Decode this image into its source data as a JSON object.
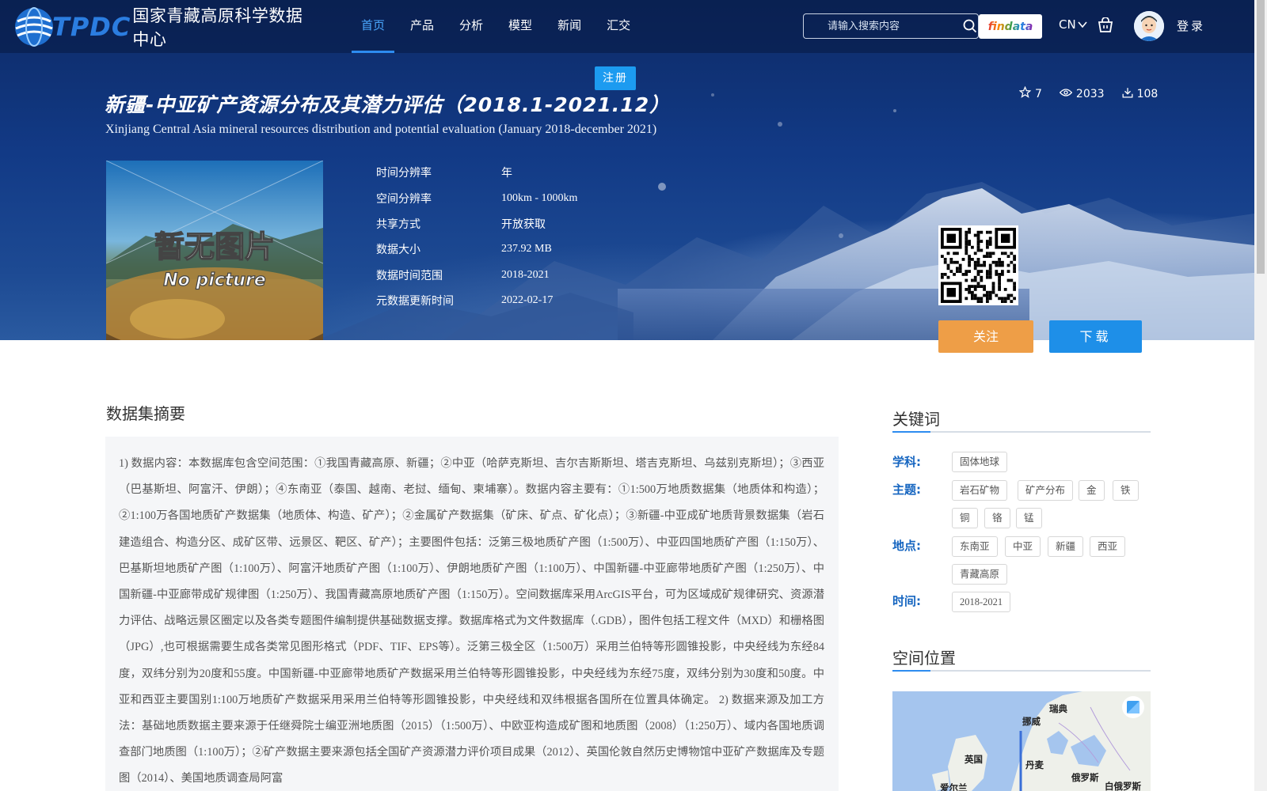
{
  "header": {
    "logo_text": "TPDC",
    "logo_cn": "国家青藏高原科学数据中心",
    "nav": [
      {
        "label": "首页",
        "active": true
      },
      {
        "label": "产品"
      },
      {
        "label": "分析"
      },
      {
        "label": "模型"
      },
      {
        "label": "新闻"
      },
      {
        "label": "汇交"
      }
    ],
    "search_placeholder": "请输入搜索内容",
    "findata_label": "findata",
    "lang_label": "CN",
    "login_label": "登录",
    "register_label": "注册"
  },
  "dataset": {
    "title_cn": "新疆-中亚矿产资源分布及其潜力评估（2018.1-2021.12）",
    "title_en": "Xinjiang Central Asia mineral resources distribution and potential evaluation (January 2018-december 2021)",
    "stats": {
      "stars": "7",
      "views": "2033",
      "downloads": "108"
    },
    "thumbnail": {
      "text_cn": "暂无图片",
      "text_en": "No picture"
    },
    "meta": [
      {
        "label": "时间分辨率",
        "value": "年"
      },
      {
        "label": "空间分辨率",
        "value": "100km - 1000km"
      },
      {
        "label": "共享方式",
        "value": "开放获取"
      },
      {
        "label": "数据大小",
        "value": "237.92 MB"
      },
      {
        "label": "数据时间范围",
        "value": "2018-2021"
      },
      {
        "label": "元数据更新时间",
        "value": "2022-02-17"
      }
    ],
    "follow_label": "关注",
    "download_label": "下载"
  },
  "abstract": {
    "title": "数据集摘要",
    "text": "1) 数据内容：本数据库包含空间范围：①我国青藏高原、新疆；②中亚（哈萨克斯坦、吉尔吉斯斯坦、塔吉克斯坦、乌兹别克斯坦）；③西亚（巴基斯坦、阿富汗、伊朗）；④东南亚（泰国、越南、老挝、缅甸、柬埔寨）。数据内容主要有：①1:500万地质数据集（地质体和构造）；②1:100万各国地质矿产数据集（地质体、构造、矿产）；②金属矿产数据集（矿床、矿点、矿化点）；③新疆-中亚成矿地质背景数据集（岩石建造组合、构造分区、成矿区带、远景区、靶区、矿产）；主要图件包括：泛第三极地质矿产图（1:500万）、中亚四国地质矿产图（1:150万）、巴基斯坦地质矿产图（1:100万）、阿富汗地质矿产图（1:100万）、伊朗地质矿产图（1:100万）、中国新疆-中亚廊带地质矿产图（1:250万）、中国新疆-中亚廊带成矿规律图（1:250万）、我国青藏高原地质矿产图（1:150万）。空间数据库采用ArcGIS平台，可为区域成矿规律研究、资源潜力评估、战略远景区圈定以及各类专题图件编制提供基础数据支撑。数据库格式为文件数据库（.GDB），图件包括工程文件（MXD）和栅格图（JPG）,也可根据需要生成各类常见图形格式（PDF、TIF、EPS等）。泛第三极全区（1:500万）采用兰伯特等形圆锥投影，中央经线为东经84度，双纬分别为20度和55度。中国新疆-中亚廊带地质矿产数据采用兰伯特等形圆锥投影，中央经线为东经75度，双纬分别为30度和50度。中亚和西亚主要国别1:100万地质矿产数据采用采用兰伯特等形圆锥投影，中央经线和双纬根据各国所在位置具体确定。 2) 数据来源及加工方法：基础地质数据主要来源于任继舜院士编亚洲地质图（2015）（1:500万）、中欧亚构造成矿图和地质图（2008）（1:250万）、域内各国地质调查部门地质图（1:100万）；②矿产数据主要来源包括全国矿产资源潜力评价项目成果（2012）、英国伦敦自然历史博物馆中亚矿产数据库及专题图（2014）、美国地质调查局阿富"
  },
  "keywords": {
    "title": "关键词",
    "groups": [
      {
        "label": "学科:",
        "tags": [
          "固体地球"
        ]
      },
      {
        "label": "主题:",
        "tags": [
          "岩石矿物",
          "矿产分布",
          "金",
          "铁",
          "铜",
          "铬",
          "锰"
        ]
      },
      {
        "label": "地点:",
        "tags": [
          "东南亚",
          "中亚",
          "新疆",
          "西亚",
          "青藏高原"
        ]
      },
      {
        "label": "时间:",
        "tags": [
          "2018-2021"
        ]
      }
    ]
  },
  "spatial": {
    "title": "空间位置",
    "map_labels": [
      "瑞典",
      "挪威",
      "英国",
      "丹麦",
      "俄罗斯",
      "白俄罗斯",
      "爱尔兰"
    ]
  },
  "colors": {
    "accent": "#2d8cf0",
    "follow": "#ee9e47",
    "download": "#1e8fe8",
    "keyword_label": "#1565c0"
  }
}
